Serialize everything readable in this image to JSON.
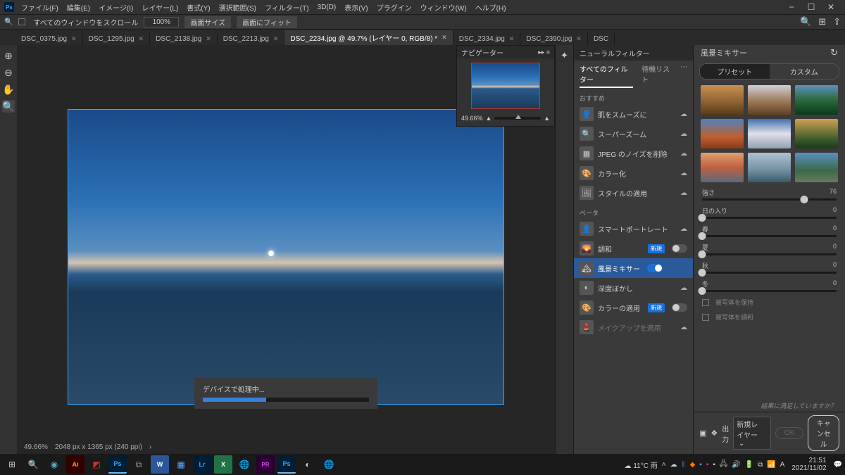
{
  "menubar": [
    "ファイル(F)",
    "編集(E)",
    "イメージ(I)",
    "レイヤー(L)",
    "書式(Y)",
    "選択範囲(S)",
    "フィルター(T)",
    "3D(D)",
    "表示(V)",
    "プラグイン",
    "ウィンドウ(W)",
    "ヘルプ(H)"
  ],
  "optionbar": {
    "scroll_label": "すべてのウィンドウをスクロール",
    "zoom_value": "100%",
    "fit_screen": "画面サイズ",
    "fit_window": "画面にフィット"
  },
  "tabs": [
    {
      "label": "DSC_0375.jpg",
      "active": false
    },
    {
      "label": "DSC_1295.jpg",
      "active": false
    },
    {
      "label": "DSC_2138.jpg",
      "active": false
    },
    {
      "label": "DSC_2213.jpg",
      "active": false
    },
    {
      "label": "DSC_2234.jpg @ 49.7% (レイヤー 0, RGB/8) *",
      "active": true
    },
    {
      "label": "DSC_2334.jpg",
      "active": false
    },
    {
      "label": "DSC_2390.jpg",
      "active": false
    },
    {
      "label": "DSC",
      "active": false
    }
  ],
  "navigator": {
    "title": "ナビゲーター",
    "zoom": "49.66%"
  },
  "progress": {
    "label": "デバイスで処理中..."
  },
  "status": {
    "zoom": "49.66%",
    "dims": "2048 px x 1365 px (240 ppi)"
  },
  "neural": {
    "title": "ニューラルフィルター",
    "tab_all": "すべてのフィルター",
    "tab_wait": "待機リスト",
    "sec_featured": "おすすめ",
    "sec_beta": "ベータ",
    "featured": [
      "肌をスムーズに",
      "スーパーズーム",
      "JPEG のノイズを削除",
      "カラー化",
      "スタイルの適用"
    ],
    "beta": [
      {
        "label": "スマートポートレート",
        "state": "cloud"
      },
      {
        "label": "調和",
        "state": "new"
      },
      {
        "label": "風景ミキサー",
        "state": "active"
      },
      {
        "label": "深度ぼかし",
        "state": "cloud"
      },
      {
        "label": "カラーの適用",
        "state": "new"
      },
      {
        "label": "メイクアップを適用",
        "state": "cloud-disabled"
      }
    ],
    "badge_new": "新規"
  },
  "mixer": {
    "title": "風景ミキサー",
    "tab_preset": "プリセット",
    "tab_custom": "カスタム",
    "sliders": [
      {
        "label": "強さ",
        "value": "76",
        "pos": 76
      },
      {
        "label": "日の入り",
        "value": "0",
        "pos": 0
      },
      {
        "label": "春",
        "value": "0",
        "pos": 0
      },
      {
        "label": "夏",
        "value": "0",
        "pos": 0
      },
      {
        "label": "秋",
        "value": "0",
        "pos": 0
      },
      {
        "label": "冬",
        "value": "0",
        "pos": 0
      }
    ],
    "check_preserve": "被写体を保持",
    "check_harmonize": "被写体を調和",
    "feedback": "結果に満足していますか？",
    "output_label": "出力",
    "output_value": "新規レイヤー",
    "btn_ok": "OK",
    "btn_cancel": "キャンセル"
  },
  "taskbar": {
    "weather": "11°C 雨",
    "time": "21:51",
    "date": "2021/11/02"
  }
}
